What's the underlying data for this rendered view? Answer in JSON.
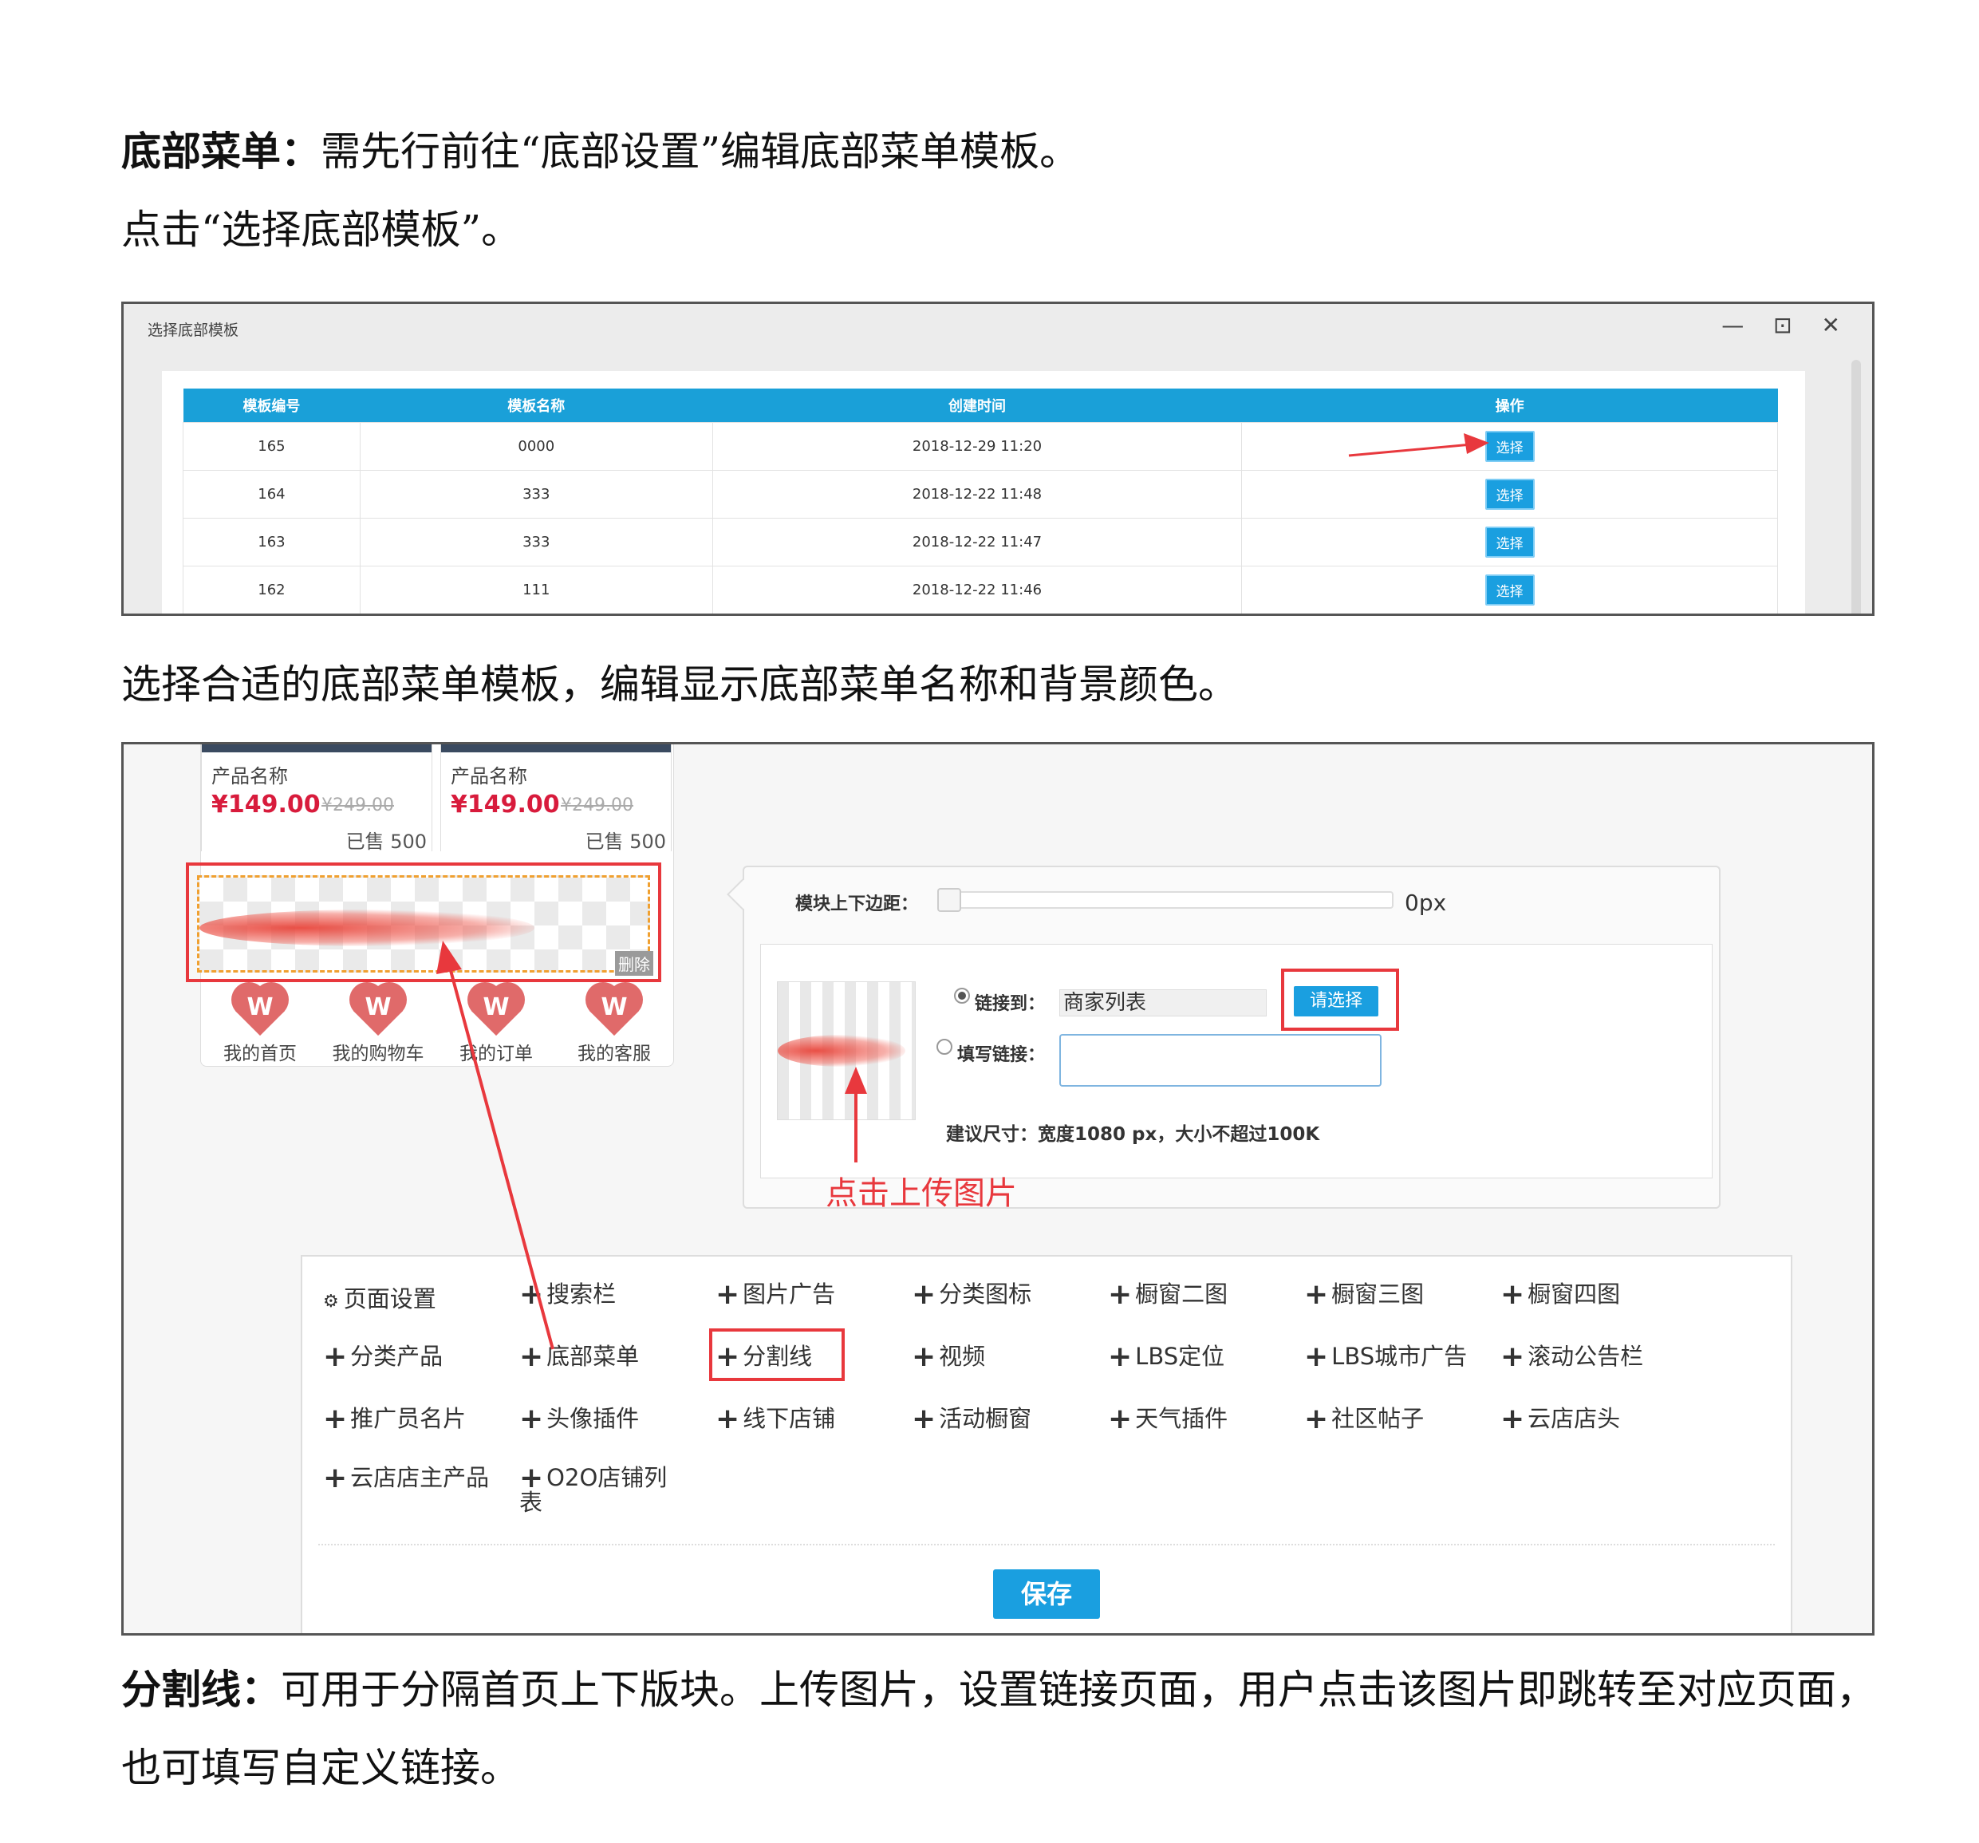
{
  "doc": {
    "p1_bold": "底部菜单：",
    "p1_text": "需先行前往“底部设置”编辑底部菜单模板。",
    "p2_text": "点击“选择底部模板”。",
    "p3_text": "选择合适的底部菜单模板，编辑显示底部菜单名称和背景颜色。",
    "p4_bold": "分割线：",
    "p4_text": "可用于分隔首页上下版块。上传图片，设置链接页面，用户点击该图片即跳转至对应页面，",
    "p5_text": "也可填写自定义链接。"
  },
  "dialog": {
    "title": "选择底部模板",
    "controls": "—  ⊡  ✕",
    "columns": [
      "模板编号",
      "模板名称",
      "创建时间",
      "操作"
    ],
    "rows": [
      {
        "id": "165",
        "name": "0000",
        "time": "2018-12-29 11:20",
        "action": "选择"
      },
      {
        "id": "164",
        "name": "333",
        "time": "2018-12-22 11:48",
        "action": "选择"
      },
      {
        "id": "163",
        "name": "333",
        "time": "2018-12-22 11:47",
        "action": "选择"
      },
      {
        "id": "162",
        "name": "111",
        "time": "2018-12-22 11:46",
        "action": "选择"
      }
    ]
  },
  "editor": {
    "products": [
      {
        "name": "产品名称",
        "price": "¥149.00",
        "old_price": "¥249.00",
        "sold": "已售 500"
      },
      {
        "name": "产品名称",
        "price": "¥149.00",
        "old_price": "¥249.00",
        "sold": "已售 500"
      }
    ],
    "delete_label": "删除",
    "nav_icon_letter": "W",
    "nav": [
      "我的首页",
      "我的购物车",
      "我的订单",
      "我的客服"
    ],
    "margin_label": "模块上下边距：",
    "margin_value": "0px",
    "link_to_label": "链接到：",
    "link_to_value": "商家列表",
    "choose_button": "请选择",
    "custom_link_label": "填写链接：",
    "size_hint": "建议尺寸：宽度1080 px，大小不超过100K",
    "upload_note": "点击上传图片",
    "widgets": [
      "页面设置",
      "搜索栏",
      "图片广告",
      "分类图标",
      "橱窗二图",
      "橱窗三图",
      "橱窗四图",
      "分类产品",
      "底部菜单",
      "分割线",
      "视频",
      "LBS定位",
      "LBS城市广告",
      "滚动公告栏",
      "推广员名片",
      "头像插件",
      "线下店铺",
      "活动橱窗",
      "天气插件",
      "社区帖子",
      "云店店头",
      "云店店主产品",
      "O2O店铺列表"
    ],
    "save_button": "保存"
  },
  "colors": {
    "accent_blue": "#1a9fe0",
    "highlight_red": "#e8383d",
    "price_red": "#d81b3c"
  }
}
